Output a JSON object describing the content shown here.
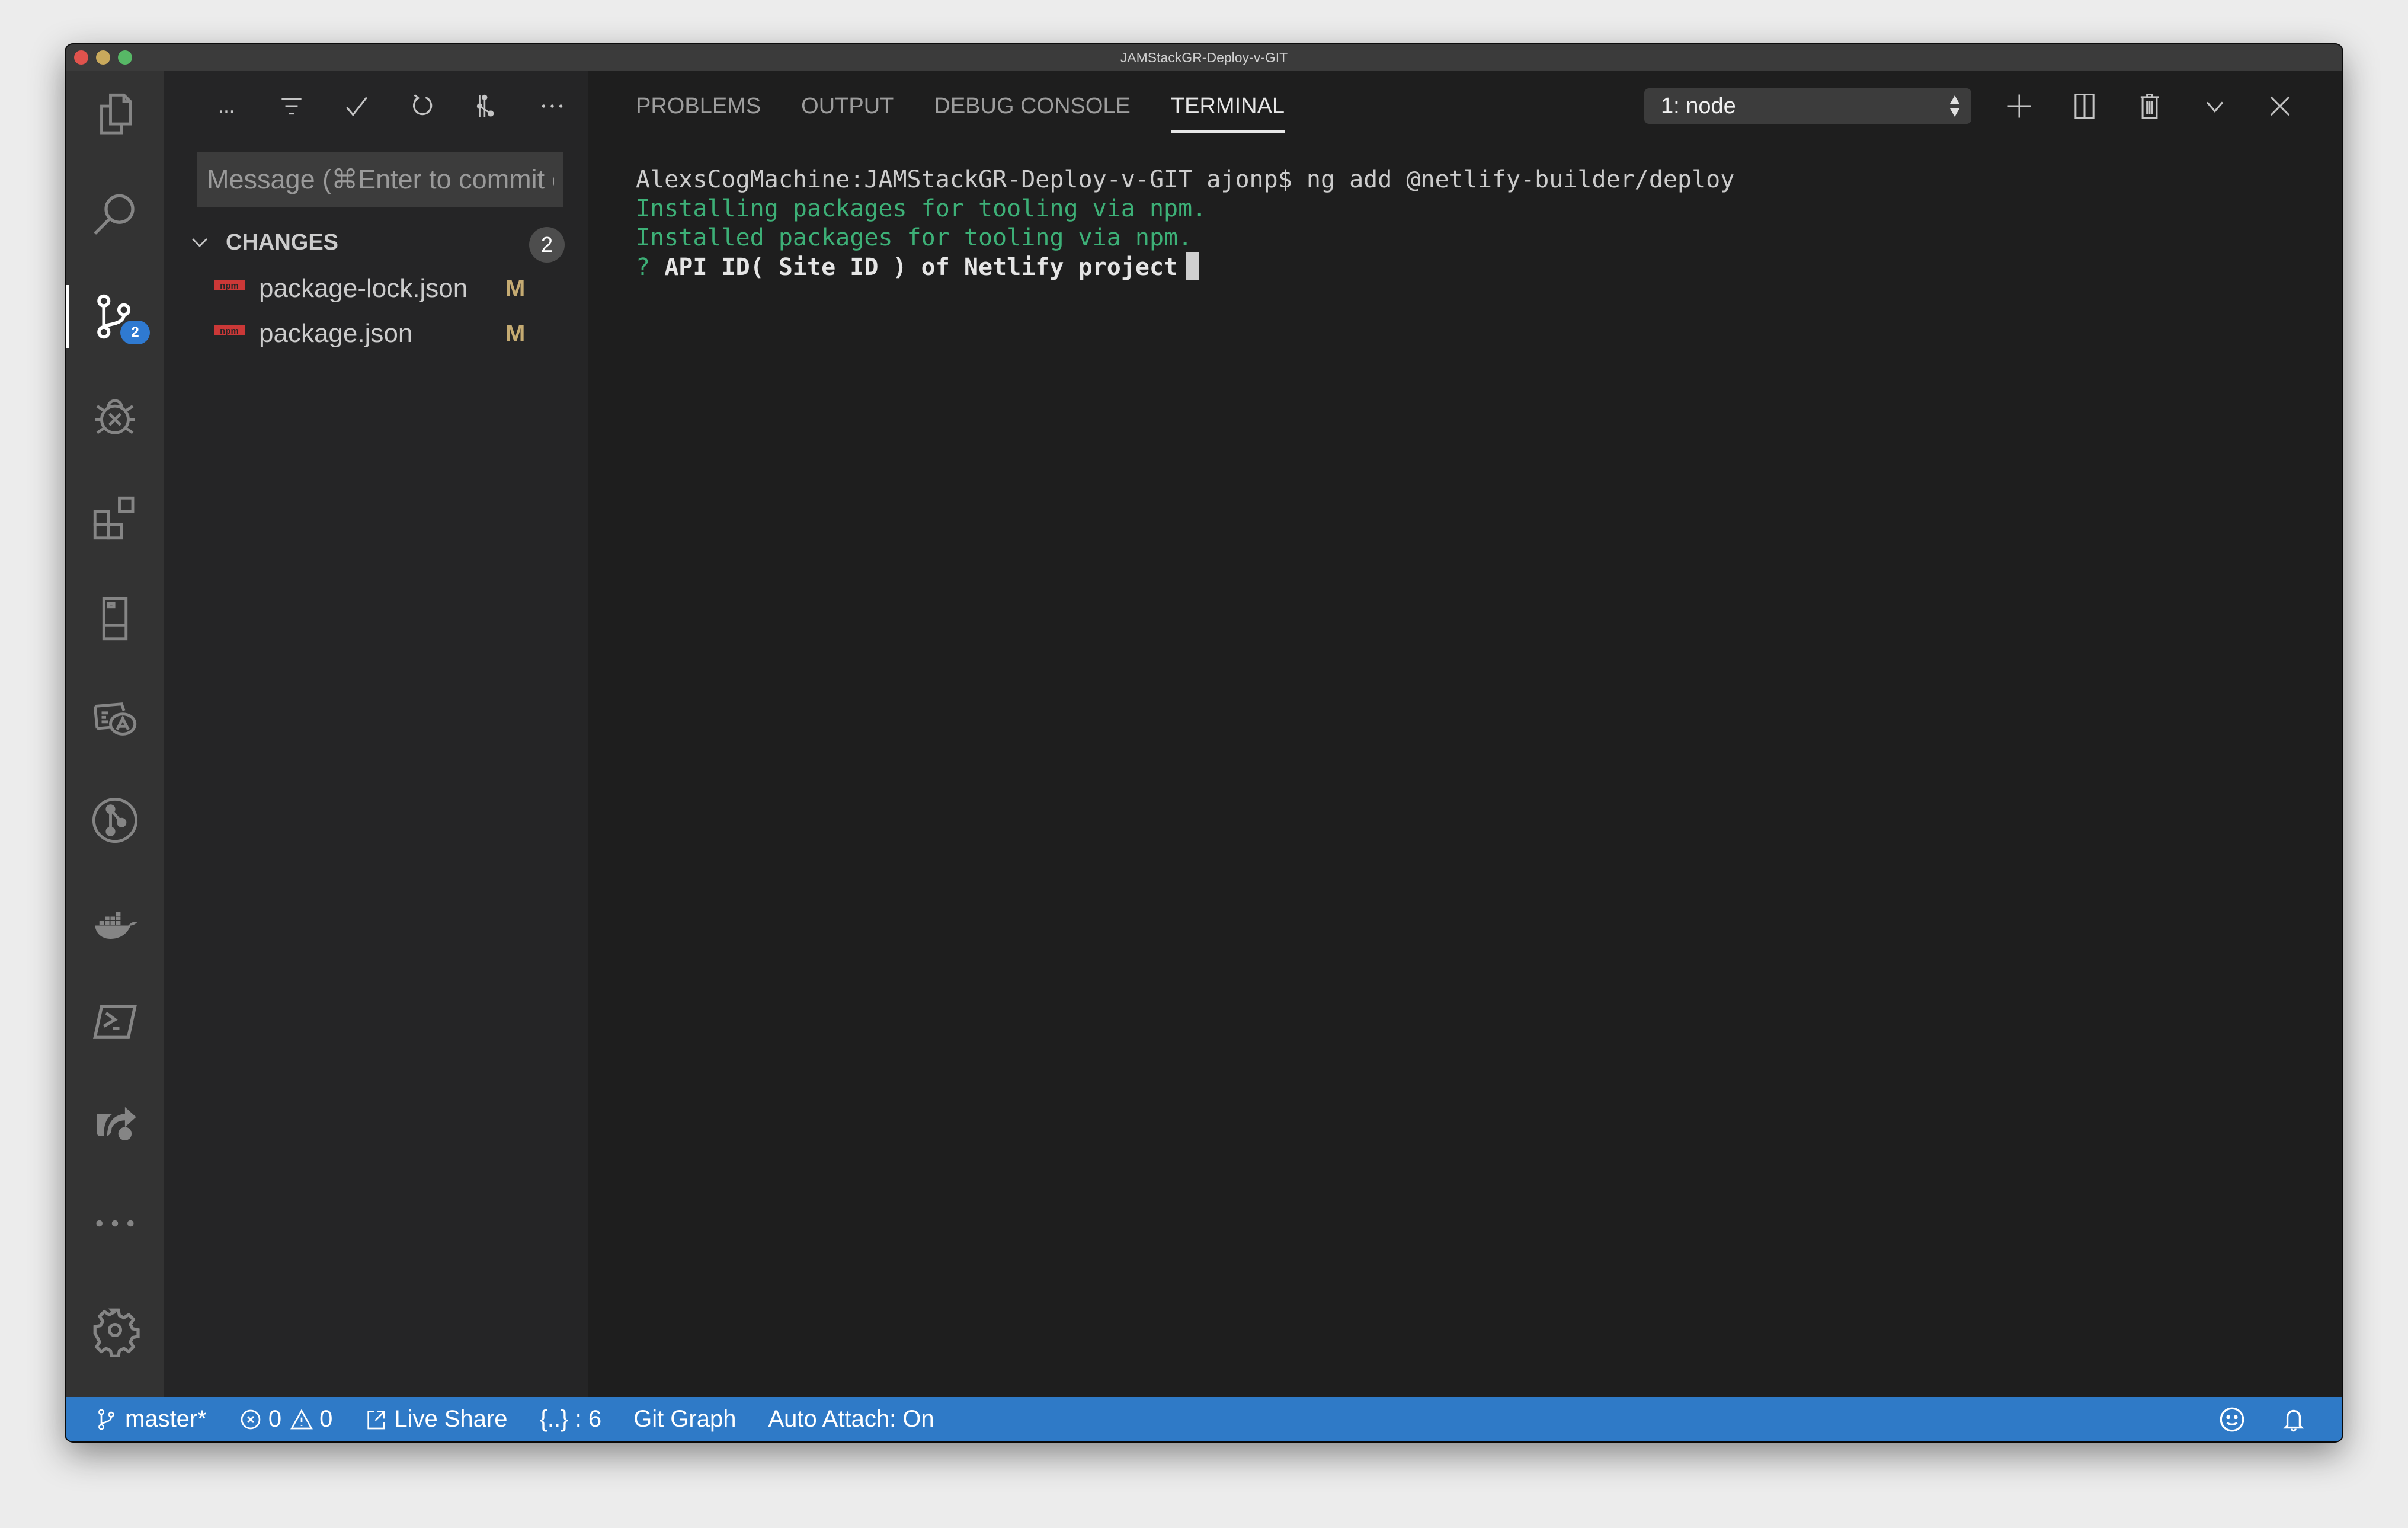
{
  "window": {
    "title": "JAMStackGR-Deploy-v-GIT"
  },
  "activity_bar": {
    "items": [
      {
        "name": "explorer",
        "icon": "files-icon"
      },
      {
        "name": "search",
        "icon": "search-icon"
      },
      {
        "name": "source-control",
        "icon": "source-control-icon",
        "badge": "2",
        "active": true
      },
      {
        "name": "debug",
        "icon": "debug-icon"
      },
      {
        "name": "extensions",
        "icon": "extensions-icon"
      },
      {
        "name": "remote-explorer",
        "icon": "remote-explorer-icon"
      },
      {
        "name": "translation",
        "icon": "translation-icon"
      },
      {
        "name": "git-graph",
        "icon": "git-graph-icon"
      },
      {
        "name": "docker",
        "icon": "docker-icon"
      },
      {
        "name": "powershell",
        "icon": "powershell-icon"
      },
      {
        "name": "live-share",
        "icon": "live-share-icon"
      },
      {
        "name": "more",
        "icon": "ellipsis-icon"
      }
    ],
    "settings_icon": "gear-icon"
  },
  "source_control": {
    "toolbar": {
      "more_label": "...",
      "actions": [
        "view-as-tree",
        "commit",
        "refresh",
        "git-graph",
        "more-actions"
      ]
    },
    "commit_placeholder": "Message (⌘Enter to commit on 'master')",
    "changes": {
      "label": "CHANGES",
      "count": "2",
      "files": [
        {
          "name": "package-lock.json",
          "status": "M",
          "icon": "npm-icon"
        },
        {
          "name": "package.json",
          "status": "M",
          "icon": "npm-icon"
        }
      ]
    }
  },
  "panel": {
    "tabs": [
      {
        "label": "PROBLEMS",
        "active": false
      },
      {
        "label": "OUTPUT",
        "active": false
      },
      {
        "label": "DEBUG CONSOLE",
        "active": false
      },
      {
        "label": "TERMINAL",
        "active": true
      }
    ],
    "terminal_select": "1: node",
    "terminal": {
      "prompt_line": "AlexsCogMachine:JAMStackGR-Deploy-v-GIT ajonp$ ng add @netlify-builder/deploy",
      "output_lines": [
        "Installing packages for tooling via npm.",
        "Installed packages for tooling via npm."
      ],
      "question_mark": "?",
      "question": "API ID( Site ID ) of Netlify project"
    }
  },
  "status_bar": {
    "branch": "master*",
    "errors": "0",
    "warnings": "0",
    "live_share": "Live Share",
    "json_count": "{..} : 6",
    "git_graph": "Git Graph",
    "auto_attach": "Auto Attach: On"
  },
  "colors": {
    "status_bar": "#2f7ac7",
    "accent_badge": "#2f7ad1",
    "terminal_green": "#3db077",
    "modified": "#c5ab72",
    "npm_red": "#cb3837"
  }
}
